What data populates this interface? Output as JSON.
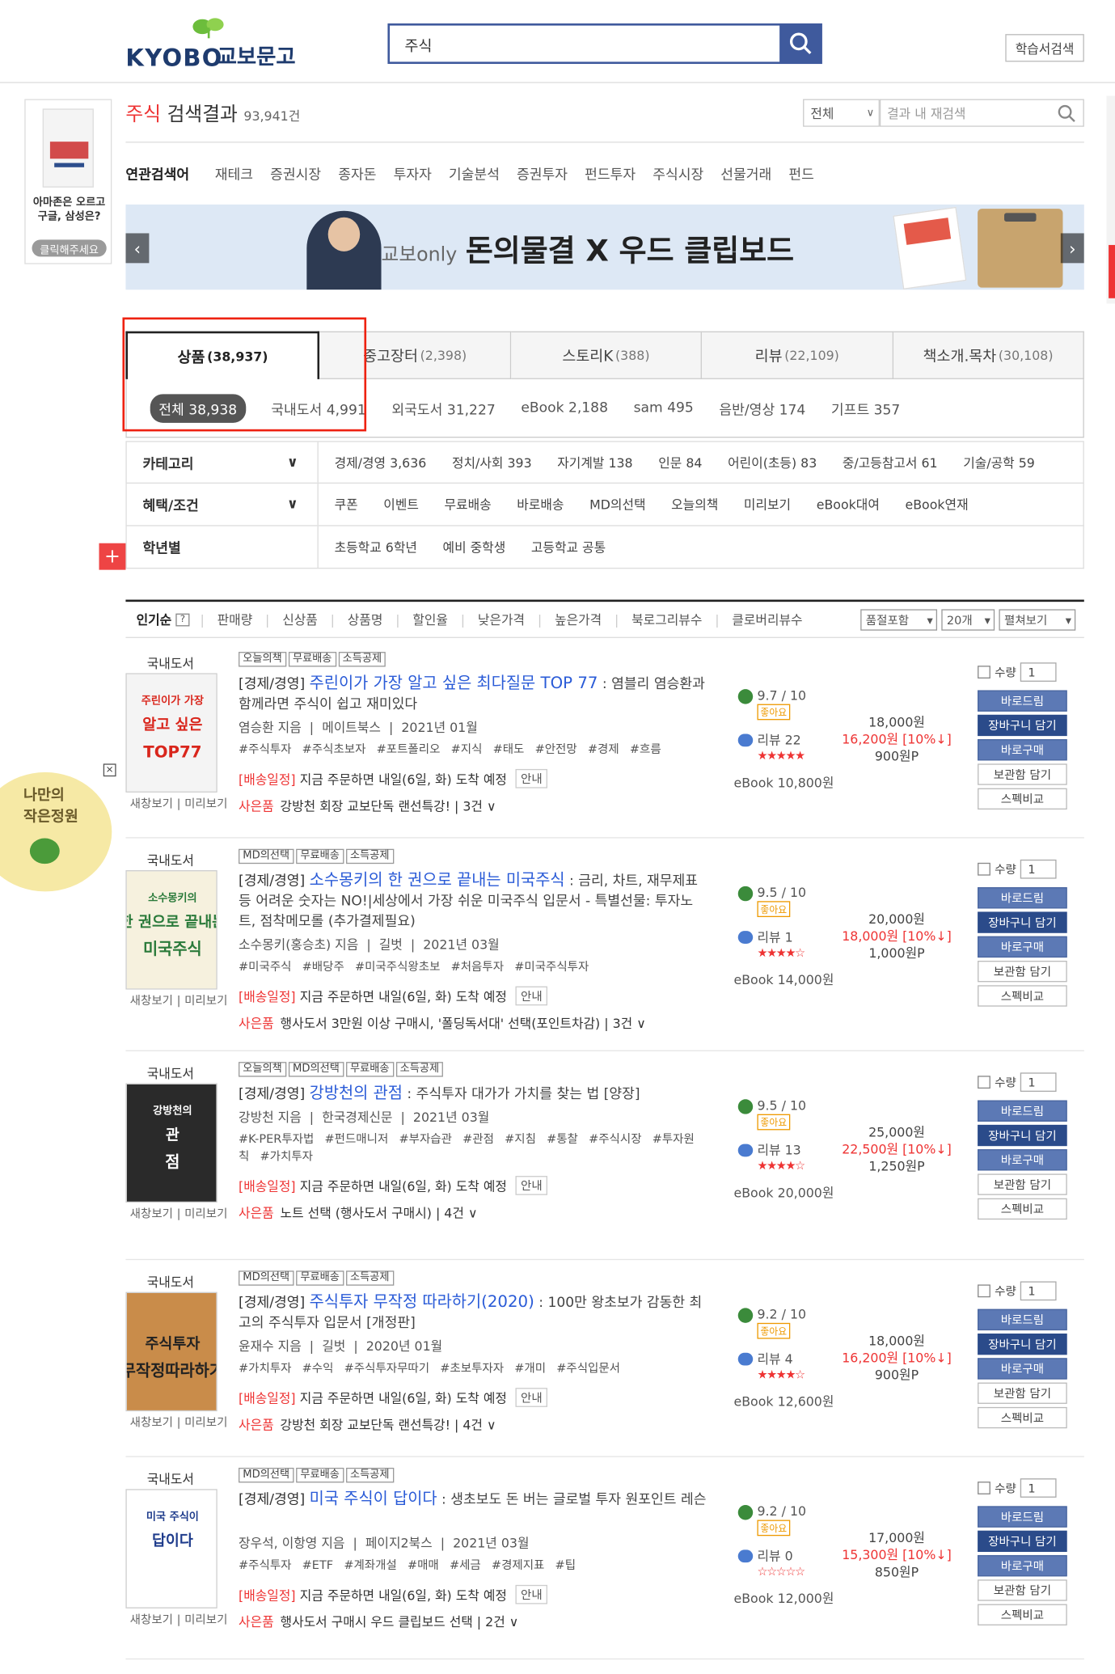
{
  "header": {
    "logo_en": "KYOBO",
    "logo_kr": "교보문고",
    "search_query": "주식",
    "textbook_search": "학습서검색"
  },
  "left_banner": {
    "line1": "아마존은 오르고",
    "line2": "구글, 삼성은?",
    "cta": "클릭해주세요"
  },
  "result": {
    "keyword": "주식",
    "label": "검색결과",
    "count": "93,941건",
    "scope": "전체",
    "refine_placeholder": "결과 내 재검색"
  },
  "related": {
    "label": "연관검색어",
    "items": [
      "재테크",
      "증권시장",
      "종자돈",
      "투자자",
      "기술분석",
      "증권투자",
      "펀드투자",
      "주식시장",
      "선물거래",
      "펀드"
    ]
  },
  "ad": {
    "only": "교보only",
    "headline": "돈의물결 X 우드 클립보드"
  },
  "tabs": [
    {
      "label": "상품",
      "count": "(38,937)"
    },
    {
      "label": "중고장터",
      "count": "(2,398)"
    },
    {
      "label": "스토리K",
      "count": "(388)"
    },
    {
      "label": "리뷰",
      "count": "(22,109)"
    },
    {
      "label": "책소개.목차",
      "count": "(30,108)"
    }
  ],
  "subtabs": [
    "전체 38,938",
    "국내도서 4,991",
    "외국도서 31,227",
    "eBook 2,188",
    "sam 495",
    "음반/영상 174",
    "기프트 357"
  ],
  "filters": {
    "category": {
      "label": "카테고리",
      "items": [
        "경제/경영 3,636",
        "정치/사회 393",
        "자기계발 138",
        "인문 84",
        "어린이(초등) 83",
        "중/고등참고서 61",
        "기술/공학 59"
      ]
    },
    "benefit": {
      "label": "혜택/조건",
      "items": [
        "쿠폰",
        "이벤트",
        "무료배송",
        "바로배송",
        "MD의선택",
        "오늘의책",
        "미리보기",
        "eBook대여",
        "eBook연재"
      ]
    },
    "grade": {
      "label": "학년별",
      "items": [
        "초등학교 6학년",
        "예비 중학생",
        "고등학교 공통"
      ]
    }
  },
  "sort": {
    "items": [
      "인기순",
      "판매량",
      "신상품",
      "상품명",
      "할인율",
      "낮은가격",
      "높은가격",
      "북로그리뷰수",
      "클로버리뷰수"
    ],
    "help": "?",
    "stock": "품절포함",
    "per_page": "20개",
    "view": "펼쳐보기"
  },
  "common": {
    "cat": "국내도서",
    "new_window": "새창보기",
    "preview": "미리보기",
    "qty_label": "수량",
    "qty": "1",
    "good": "좋아요",
    "review_prefix": "리뷰",
    "guide": "안내",
    "gift_label": "사은품",
    "delivery_label": "[배송일정]",
    "delivery_text": "지금 주문하면 내일(6일, 화) 도착 예정",
    "buttons": [
      "바로드림",
      "장바구니 담기",
      "바로구매",
      "보관함 담기",
      "스펙비교"
    ]
  },
  "books": [
    {
      "badges": [
        "오늘의책",
        "무료배송",
        "소득공제"
      ],
      "tag": "[경제/경영]",
      "title": "주린이가 가장 알고 싶은 최다질문 TOP 77",
      "sub": " : 염블리 염승환과 함께라면 주식이 쉽고 재미있다",
      "author": "염승환 지음",
      "publisher": "메이트북스",
      "date": "2021년 01월",
      "hashes": [
        "#주식투자",
        "#주식초보자",
        "#포트폴리오",
        "#지식",
        "#태도",
        "#안전망",
        "#경제",
        "#흐름"
      ],
      "gift": "강방천 회장 교보단독 랜선특강! | 3건",
      "score": "9.7 / 10",
      "reviews": "22",
      "stars": "★★★★★",
      "ebook": "eBook 10,800원",
      "list": "18,000원",
      "sale": "16,200원 [10%↓]",
      "point": "900원P"
    },
    {
      "badges": [
        "MD의선택",
        "무료배송",
        "소득공제"
      ],
      "tag": "[경제/경영]",
      "title": "소수몽키의 한 권으로 끝내는 미국주식",
      "sub": " : 금리, 차트, 재무제표 등 어려운 숫자는 NO!|세상에서 가장 쉬운 미국주식 입문서 - 특별선물: 투자노트, 점착메모롤 (추가결제필요)",
      "author": "소수몽키(홍승초) 지음",
      "publisher": "길벗",
      "date": "2021년 03월",
      "hashes": [
        "#미국주식",
        "#배당주",
        "#미국주식왕초보",
        "#처음투자",
        "#미국주식투자"
      ],
      "gift": "행사도서 3만원 이상 구매시, '폴딩독서대' 선택(포인트차감) | 3건",
      "score": "9.5 / 10",
      "reviews": "1",
      "stars": "★★★★☆",
      "ebook": "eBook 14,000원",
      "list": "20,000원",
      "sale": "18,000원 [10%↓]",
      "point": "1,000원P"
    },
    {
      "badges": [
        "오늘의책",
        "MD의선택",
        "무료배송",
        "소득공제"
      ],
      "tag": "[경제/경영]",
      "title": "강방천의 관점",
      "sub": " : 주식투자 대가가 가치를 찾는 법 [양장]",
      "author": "강방천 지음",
      "publisher": "한국경제신문",
      "date": "2021년 03월",
      "hashes": [
        "#K-PER투자법",
        "#펀드매니저",
        "#부자습관",
        "#관점",
        "#지침",
        "#통찰",
        "#주식시장",
        "#투자원칙",
        "#가치투자"
      ],
      "gift": "노트 선택 (행사도서 구매시) | 4건",
      "score": "9.5 / 10",
      "reviews": "13",
      "stars": "★★★★☆",
      "ebook": "eBook 20,000원",
      "list": "25,000원",
      "sale": "22,500원 [10%↓]",
      "point": "1,250원P"
    },
    {
      "badges": [
        "MD의선택",
        "무료배송",
        "소득공제"
      ],
      "tag": "[경제/경영]",
      "title": "주식투자 무작정 따라하기(2020)",
      "sub": " : 100만 왕초보가 감동한 최고의 주식투자 입문서 [개정판]",
      "author": "윤재수 지음",
      "publisher": "길벗",
      "date": "2020년 01월",
      "hashes": [
        "#가치투자",
        "#수익",
        "#주식투자무따기",
        "#초보투자자",
        "#개미",
        "#주식입문서"
      ],
      "gift": "강방천 회장 교보단독 랜선특강! | 4건",
      "score": "9.2 / 10",
      "reviews": "4",
      "stars": "★★★★☆",
      "ebook": "eBook 12,600원",
      "list": "18,000원",
      "sale": "16,200원 [10%↓]",
      "point": "900원P"
    },
    {
      "badges": [
        "MD의선택",
        "무료배송",
        "소득공제"
      ],
      "tag": "[경제/경영]",
      "title": "미국 주식이 답이다",
      "sub": " : 생초보도 돈 버는 글로벌 투자 원포인트 레슨",
      "author": "장우석, 이항영 지음",
      "publisher": "페이지2북스",
      "date": "2021년 03월",
      "hashes": [
        "#주식투자",
        "#ETF",
        "#계좌개설",
        "#매매",
        "#세금",
        "#경제지표",
        "#팁"
      ],
      "gift": "행사도서 구매시 우드 클립보드 선택 | 2건",
      "score": "9.2 / 10",
      "reviews": "0",
      "stars": "☆☆☆☆☆",
      "ebook": "eBook 12,000원",
      "list": "17,000원",
      "sale": "15,300원 [10%↓]",
      "point": "850원P"
    }
  ],
  "covers": [
    {
      "line1": "주린이가 가장",
      "line2": "알고 싶은",
      "line3": "TOP77",
      "bg": "#f4f4f4",
      "fg": "#d9261c"
    },
    {
      "line1": "소수몽키의",
      "line2": "한 권으로 끝내는",
      "line3": "미국주식",
      "bg": "#f6f1de",
      "fg": "#2a7a3a"
    },
    {
      "line1": "강방천의",
      "line2": "관",
      "line3": "점",
      "bg": "#2a2a2a",
      "fg": "#ffffff"
    },
    {
      "line1": "",
      "line2": "주식투자",
      "line3": "무작정따라하기",
      "bg": "#c98c4a",
      "fg": "#222222"
    },
    {
      "line1": "미국 주식이",
      "line2": "답이다",
      "line3": "",
      "bg": "#ffffff",
      "fg": "#1f3c8c"
    }
  ],
  "garden": {
    "line1": "나만의",
    "line2": "작은정원"
  },
  "plus": "+",
  "close": "×"
}
